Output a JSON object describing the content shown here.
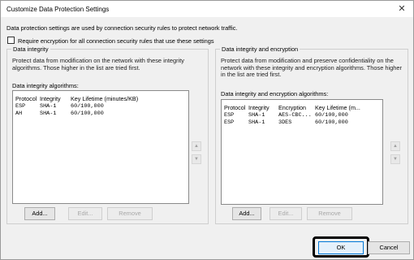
{
  "window": {
    "title": "Customize Data Protection Settings",
    "close_glyph": "✕"
  },
  "intro": "Data protection settings are used by connection security rules to protect network traffic.",
  "require_encryption": {
    "label": "Require encryption for all connection security rules that use these settings",
    "checked": false
  },
  "integrity": {
    "legend": "Data integrity",
    "description": "Protect data from modification on the network with these integrity algorithms. Those higher in the list are tried first.",
    "algorithms_label": "Data integrity algorithms:",
    "columns": [
      "Protocol",
      "Integrity",
      "Key Lifetime (minutes/KB)"
    ],
    "rows": [
      [
        "ESP",
        "SHA-1",
        "60/100,000"
      ],
      [
        "AH",
        "SHA-1",
        "60/100,000"
      ]
    ],
    "buttons": {
      "add": "Add...",
      "edit": "Edit...",
      "remove": "Remove"
    }
  },
  "integrity_encryption": {
    "legend": "Data integrity and encryption",
    "description": "Protect data from modification and preserve confidentiality on the network with these integrity and encryption algorithms. Those higher in the list are tried first.",
    "algorithms_label": "Data integrity and encryption algorithms:",
    "columns": [
      "Protocol",
      "Integrity",
      "Encryption",
      "Key Lifetime (m..."
    ],
    "rows": [
      [
        "ESP",
        "SHA-1",
        "AES-CBC...",
        "60/100,000"
      ],
      [
        "ESP",
        "SHA-1",
        "3DES",
        "60/100,000"
      ]
    ],
    "buttons": {
      "add": "Add...",
      "edit": "Edit...",
      "remove": "Remove"
    }
  },
  "footer": {
    "ok": "OK",
    "cancel": "Cancel"
  },
  "icons": {
    "move_up": "▲",
    "move_down": "▼"
  }
}
